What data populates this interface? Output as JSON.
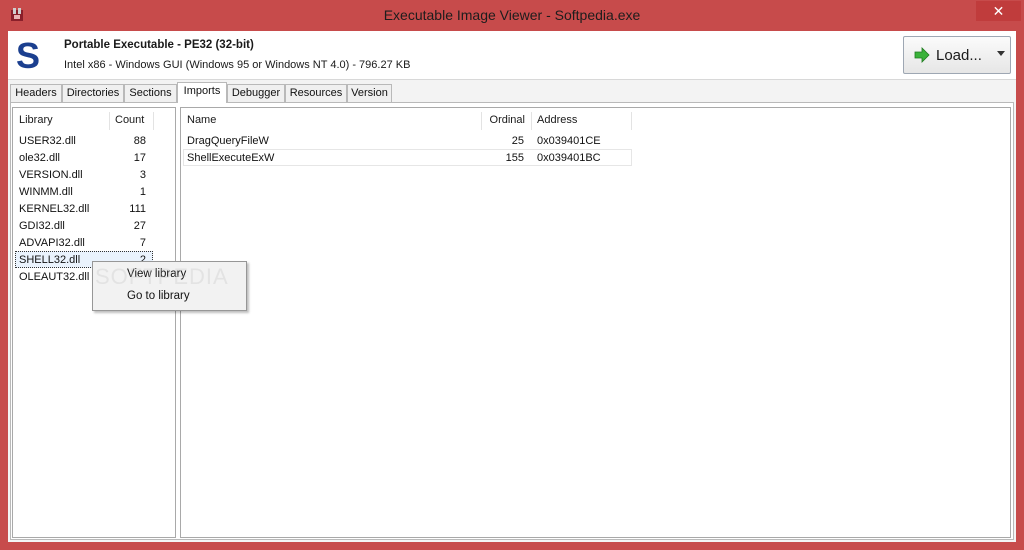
{
  "window": {
    "title": "Executable Image Viewer - Softpedia.exe",
    "close_glyph": "✕",
    "chrome_color": "#c74b4b"
  },
  "header": {
    "logo_letter": "S",
    "file_type": "Portable Executable - PE32 (32-bit)",
    "file_info": "Intel x86 - Windows GUI (Windows 95 or Windows NT 4.0) - 796.27 KB",
    "load_label": "Load...",
    "load_icon": "green-arrow-icon"
  },
  "tabs": [
    {
      "label": "Headers"
    },
    {
      "label": "Directories"
    },
    {
      "label": "Sections"
    },
    {
      "label": "Imports"
    },
    {
      "label": "Debugger"
    },
    {
      "label": "Resources"
    },
    {
      "label": "Version"
    }
  ],
  "active_tab": "Imports",
  "libraries": {
    "columns": {
      "library": "Library",
      "count": "Count"
    },
    "rows": [
      {
        "name": "USER32.dll",
        "count": "88"
      },
      {
        "name": "ole32.dll",
        "count": "17"
      },
      {
        "name": "VERSION.dll",
        "count": "3"
      },
      {
        "name": "WINMM.dll",
        "count": "1"
      },
      {
        "name": "KERNEL32.dll",
        "count": "111"
      },
      {
        "name": "GDI32.dll",
        "count": "27"
      },
      {
        "name": "ADVAPI32.dll",
        "count": "7"
      },
      {
        "name": "SHELL32.dll",
        "count": "2"
      },
      {
        "name": "OLEAUT32.dll",
        "count": ""
      }
    ],
    "selected": "SHELL32.dll"
  },
  "imports": {
    "columns": {
      "name": "Name",
      "ordinal": "Ordinal",
      "address": "Address"
    },
    "rows": [
      {
        "name": "DragQueryFileW",
        "ordinal": "25",
        "address": "0x039401CE"
      },
      {
        "name": "ShellExecuteExW",
        "ordinal": "155",
        "address": "0x039401BC"
      }
    ]
  },
  "context_menu": {
    "items": [
      "View library",
      "Go to library"
    ]
  },
  "watermark": "SOFTPEDIA"
}
